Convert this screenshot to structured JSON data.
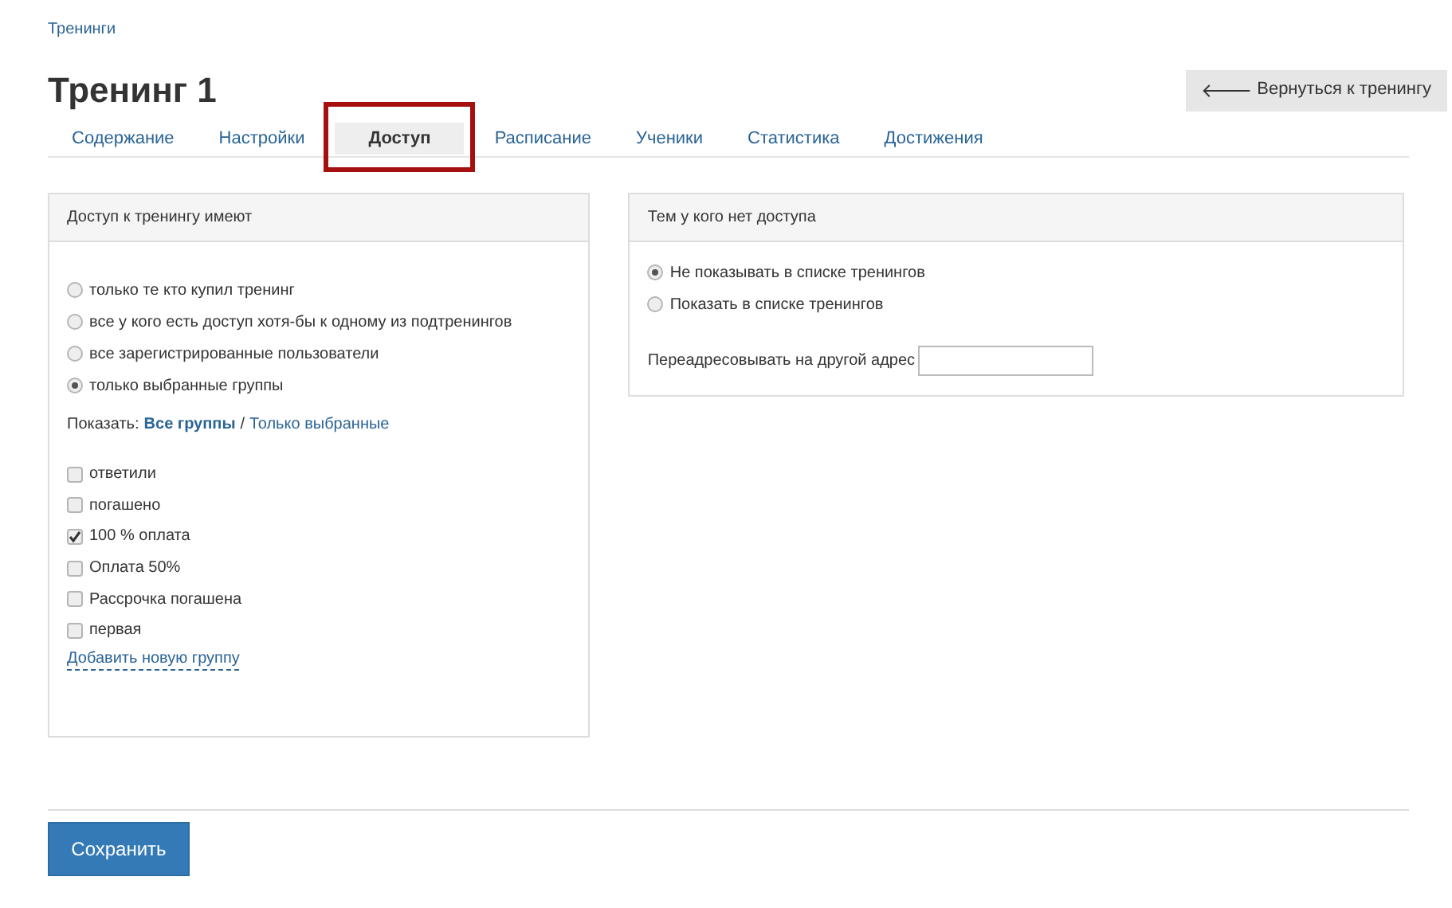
{
  "breadcrumb": "Тренинги",
  "title": "Тренинг 1",
  "back_button": {
    "arrow": "🡐",
    "label": "Вернуться к тренингу"
  },
  "tabs": [
    {
      "label": "Содержание",
      "selected": false,
      "highlighted": false
    },
    {
      "label": "Настройки",
      "selected": false,
      "highlighted": false
    },
    {
      "label": "Доступ",
      "selected": true,
      "highlighted": true
    },
    {
      "label": "Расписание",
      "selected": false,
      "highlighted": false
    },
    {
      "label": "Ученики",
      "selected": false,
      "highlighted": false
    },
    {
      "label": "Статистика",
      "selected": false,
      "highlighted": false
    },
    {
      "label": "Достижения",
      "selected": false,
      "highlighted": false
    }
  ],
  "access_panel": {
    "title": "Доступ к тренингу имеют",
    "options": [
      {
        "label": "только те кто купил тренинг",
        "selected": false
      },
      {
        "label": "все у кого есть доступ хотя-бы к одному из подтренингов",
        "selected": false
      },
      {
        "label": "все зарегистрированные пользователи",
        "selected": false
      },
      {
        "label": "только выбранные группы",
        "selected": true
      }
    ],
    "filter": {
      "label": "Показать:",
      "links": [
        {
          "label": "Все группы",
          "selected": true
        },
        {
          "label": "Только выбранные",
          "selected": false
        }
      ],
      "separator": "/"
    },
    "groups": [
      {
        "label": "ответили",
        "checked": false
      },
      {
        "label": "погашено",
        "checked": false
      },
      {
        "label": "100 % оплата",
        "checked": true
      },
      {
        "label": "Оплата 50%",
        "checked": false
      },
      {
        "label": "Рассрочка погашена",
        "checked": false
      },
      {
        "label": "первая",
        "checked": false
      }
    ],
    "add_link": "Добавить новую группу"
  },
  "no_access_panel": {
    "title": "Тем у кого нет доступа",
    "options": [
      {
        "label": "Не показывать в списке тренингов",
        "selected": true
      },
      {
        "label": "Показать в списке тренингов",
        "selected": false
      }
    ],
    "redirect_label": "Переадресовывать на другой адрес"
  },
  "save_button": "Сохранить"
}
